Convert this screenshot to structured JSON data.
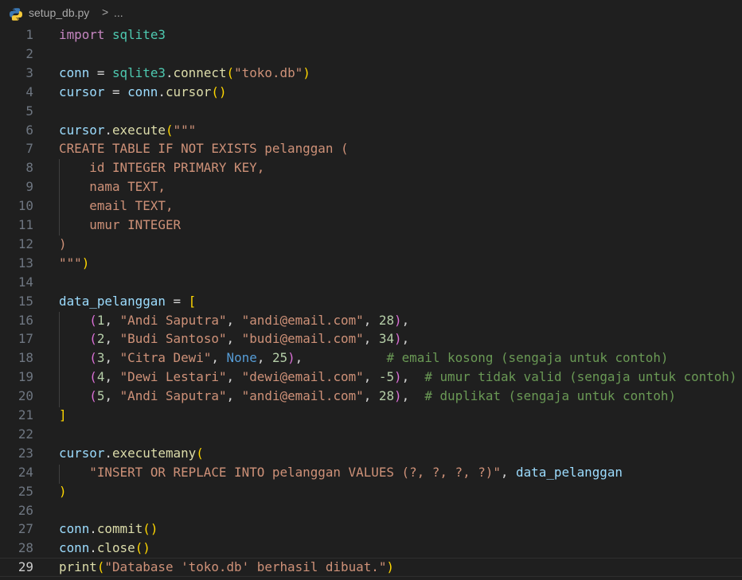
{
  "breadcrumb": {
    "file_name": "setup_db.py",
    "separator": ">",
    "more": "...",
    "file_icon": "python-icon"
  },
  "editor": {
    "current_line": 29,
    "lines": [
      {
        "n": "1",
        "tokens": [
          {
            "t": "import",
            "c": "kw"
          },
          {
            "t": " ",
            "c": "pl"
          },
          {
            "t": "sqlite3",
            "c": "mod"
          }
        ]
      },
      {
        "n": "2",
        "tokens": []
      },
      {
        "n": "3",
        "tokens": [
          {
            "t": "conn",
            "c": "var"
          },
          {
            "t": " = ",
            "c": "pl"
          },
          {
            "t": "sqlite3",
            "c": "mod"
          },
          {
            "t": ".",
            "c": "pl"
          },
          {
            "t": "connect",
            "c": "fn"
          },
          {
            "t": "(",
            "c": "b1"
          },
          {
            "t": "\"toko.db\"",
            "c": "str"
          },
          {
            "t": ")",
            "c": "b1"
          }
        ]
      },
      {
        "n": "4",
        "tokens": [
          {
            "t": "cursor",
            "c": "var"
          },
          {
            "t": " = ",
            "c": "pl"
          },
          {
            "t": "conn",
            "c": "var"
          },
          {
            "t": ".",
            "c": "pl"
          },
          {
            "t": "cursor",
            "c": "fn"
          },
          {
            "t": "()",
            "c": "b1"
          }
        ]
      },
      {
        "n": "5",
        "tokens": []
      },
      {
        "n": "6",
        "tokens": [
          {
            "t": "cursor",
            "c": "var"
          },
          {
            "t": ".",
            "c": "pl"
          },
          {
            "t": "execute",
            "c": "fn"
          },
          {
            "t": "(",
            "c": "b1"
          },
          {
            "t": "\"\"\"",
            "c": "str"
          }
        ]
      },
      {
        "n": "7",
        "tokens": [
          {
            "t": "CREATE TABLE IF NOT EXISTS pelanggan (",
            "c": "str"
          }
        ]
      },
      {
        "n": "8",
        "tokens": [
          {
            "t": "    id INTEGER PRIMARY KEY,",
            "c": "str"
          }
        ]
      },
      {
        "n": "9",
        "tokens": [
          {
            "t": "    nama TEXT,",
            "c": "str"
          }
        ]
      },
      {
        "n": "10",
        "tokens": [
          {
            "t": "    email TEXT,",
            "c": "str"
          }
        ]
      },
      {
        "n": "11",
        "tokens": [
          {
            "t": "    umur INTEGER",
            "c": "str"
          }
        ]
      },
      {
        "n": "12",
        "tokens": [
          {
            "t": ")",
            "c": "str"
          }
        ]
      },
      {
        "n": "13",
        "tokens": [
          {
            "t": "\"\"\"",
            "c": "str"
          },
          {
            "t": ")",
            "c": "b1"
          }
        ]
      },
      {
        "n": "14",
        "tokens": []
      },
      {
        "n": "15",
        "tokens": [
          {
            "t": "data_pelanggan",
            "c": "var"
          },
          {
            "t": " = ",
            "c": "pl"
          },
          {
            "t": "[",
            "c": "b1"
          }
        ]
      },
      {
        "n": "16",
        "tokens": [
          {
            "t": "    ",
            "c": "pl"
          },
          {
            "t": "(",
            "c": "b2"
          },
          {
            "t": "1",
            "c": "num"
          },
          {
            "t": ", ",
            "c": "pl"
          },
          {
            "t": "\"Andi Saputra\"",
            "c": "str"
          },
          {
            "t": ", ",
            "c": "pl"
          },
          {
            "t": "\"andi@email.com\"",
            "c": "str"
          },
          {
            "t": ", ",
            "c": "pl"
          },
          {
            "t": "28",
            "c": "num"
          },
          {
            "t": ")",
            "c": "b2"
          },
          {
            "t": ",",
            "c": "pl"
          }
        ]
      },
      {
        "n": "17",
        "tokens": [
          {
            "t": "    ",
            "c": "pl"
          },
          {
            "t": "(",
            "c": "b2"
          },
          {
            "t": "2",
            "c": "num"
          },
          {
            "t": ", ",
            "c": "pl"
          },
          {
            "t": "\"Budi Santoso\"",
            "c": "str"
          },
          {
            "t": ", ",
            "c": "pl"
          },
          {
            "t": "\"budi@email.com\"",
            "c": "str"
          },
          {
            "t": ", ",
            "c": "pl"
          },
          {
            "t": "34",
            "c": "num"
          },
          {
            "t": ")",
            "c": "b2"
          },
          {
            "t": ",",
            "c": "pl"
          }
        ]
      },
      {
        "n": "18",
        "tokens": [
          {
            "t": "    ",
            "c": "pl"
          },
          {
            "t": "(",
            "c": "b2"
          },
          {
            "t": "3",
            "c": "num"
          },
          {
            "t": ", ",
            "c": "pl"
          },
          {
            "t": "\"Citra Dewi\"",
            "c": "str"
          },
          {
            "t": ", ",
            "c": "pl"
          },
          {
            "t": "None",
            "c": "con"
          },
          {
            "t": ", ",
            "c": "pl"
          },
          {
            "t": "25",
            "c": "num"
          },
          {
            "t": ")",
            "c": "b2"
          },
          {
            "t": ",           ",
            "c": "pl"
          },
          {
            "t": "# email kosong (sengaja untuk contoh)",
            "c": "cmt"
          }
        ]
      },
      {
        "n": "19",
        "tokens": [
          {
            "t": "    ",
            "c": "pl"
          },
          {
            "t": "(",
            "c": "b2"
          },
          {
            "t": "4",
            "c": "num"
          },
          {
            "t": ", ",
            "c": "pl"
          },
          {
            "t": "\"Dewi Lestari\"",
            "c": "str"
          },
          {
            "t": ", ",
            "c": "pl"
          },
          {
            "t": "\"dewi@email.com\"",
            "c": "str"
          },
          {
            "t": ", ",
            "c": "pl"
          },
          {
            "t": "-5",
            "c": "num"
          },
          {
            "t": ")",
            "c": "b2"
          },
          {
            "t": ",  ",
            "c": "pl"
          },
          {
            "t": "# umur tidak valid (sengaja untuk contoh)",
            "c": "cmt"
          }
        ]
      },
      {
        "n": "20",
        "tokens": [
          {
            "t": "    ",
            "c": "pl"
          },
          {
            "t": "(",
            "c": "b2"
          },
          {
            "t": "5",
            "c": "num"
          },
          {
            "t": ", ",
            "c": "pl"
          },
          {
            "t": "\"Andi Saputra\"",
            "c": "str"
          },
          {
            "t": ", ",
            "c": "pl"
          },
          {
            "t": "\"andi@email.com\"",
            "c": "str"
          },
          {
            "t": ", ",
            "c": "pl"
          },
          {
            "t": "28",
            "c": "num"
          },
          {
            "t": ")",
            "c": "b2"
          },
          {
            "t": ",  ",
            "c": "pl"
          },
          {
            "t": "# duplikat (sengaja untuk contoh)",
            "c": "cmt"
          }
        ]
      },
      {
        "n": "21",
        "tokens": [
          {
            "t": "]",
            "c": "b1"
          }
        ]
      },
      {
        "n": "22",
        "tokens": []
      },
      {
        "n": "23",
        "tokens": [
          {
            "t": "cursor",
            "c": "var"
          },
          {
            "t": ".",
            "c": "pl"
          },
          {
            "t": "executemany",
            "c": "fn"
          },
          {
            "t": "(",
            "c": "b1"
          }
        ]
      },
      {
        "n": "24",
        "tokens": [
          {
            "t": "    ",
            "c": "pl"
          },
          {
            "t": "\"INSERT OR REPLACE INTO pelanggan VALUES (?, ?, ?, ?)\"",
            "c": "str"
          },
          {
            "t": ", ",
            "c": "pl"
          },
          {
            "t": "data_pelanggan",
            "c": "var"
          }
        ]
      },
      {
        "n": "25",
        "tokens": [
          {
            "t": ")",
            "c": "b1"
          }
        ]
      },
      {
        "n": "26",
        "tokens": []
      },
      {
        "n": "27",
        "tokens": [
          {
            "t": "conn",
            "c": "var"
          },
          {
            "t": ".",
            "c": "pl"
          },
          {
            "t": "commit",
            "c": "fn"
          },
          {
            "t": "()",
            "c": "b1"
          }
        ]
      },
      {
        "n": "28",
        "tokens": [
          {
            "t": "conn",
            "c": "var"
          },
          {
            "t": ".",
            "c": "pl"
          },
          {
            "t": "close",
            "c": "fn"
          },
          {
            "t": "()",
            "c": "b1"
          }
        ]
      },
      {
        "n": "29",
        "tokens": [
          {
            "t": "print",
            "c": "fn"
          },
          {
            "t": "(",
            "c": "b1"
          },
          {
            "t": "\"Database 'toko.db' berhasil dibuat.\"",
            "c": "str"
          },
          {
            "t": ")",
            "c": "b1"
          }
        ]
      }
    ]
  }
}
